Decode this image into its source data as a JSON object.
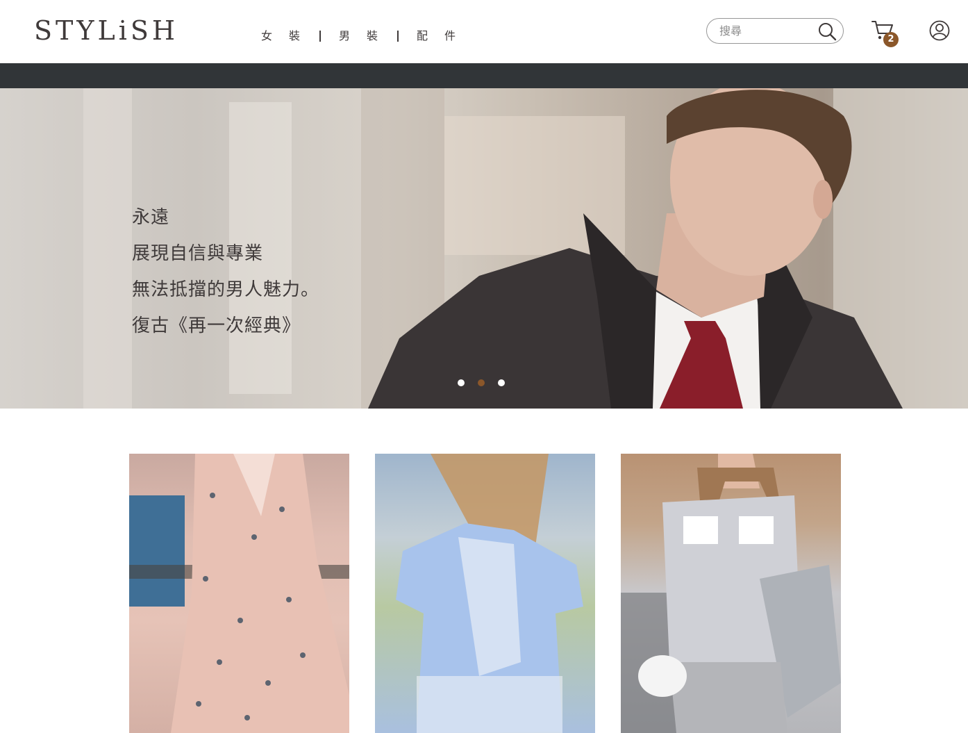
{
  "header": {
    "logo": "STYLiSH",
    "nav": [
      "女裝",
      "男裝",
      "配件"
    ],
    "search_placeholder": "搜尋",
    "cart_count": "2"
  },
  "hero": {
    "lines": [
      "永遠",
      "展現自信與專業",
      "無法抵擋的男人魅力。",
      "復古《再一次經典》"
    ],
    "active_slide": 2,
    "slide_count": 3
  },
  "products": [
    {
      "image": "woman in pink bird-print wrap dress by the sea"
    },
    {
      "image": "woman in light blue blouse, back view"
    },
    {
      "image": "woman in grey sheer shirt with shell pockets"
    }
  ],
  "colors": {
    "accent": "#8b572a",
    "dark_bar": "#313538",
    "text": "#3f3a3a"
  }
}
